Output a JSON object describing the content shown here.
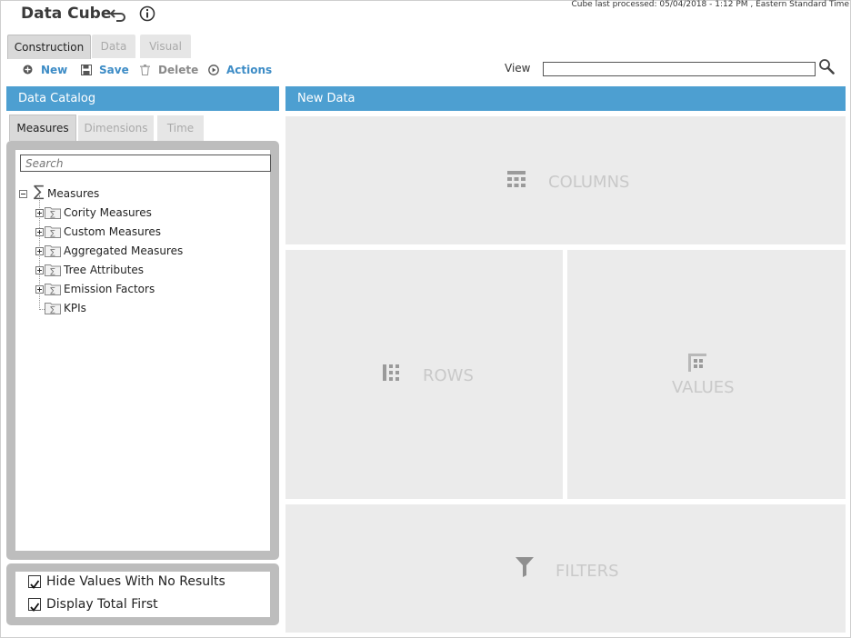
{
  "app": {
    "title": "Data Cube",
    "processed": "Cube last processed:  05/04/2018 - 1:12 PM , Eastern Standard Time"
  },
  "mode_tabs": [
    {
      "label": "Construction",
      "active": true
    },
    {
      "label": "Data",
      "active": false
    },
    {
      "label": "Visual",
      "active": false
    }
  ],
  "toolbar": {
    "new_label": "New",
    "save_label": "Save",
    "delete_label": "Delete",
    "actions_label": "Actions",
    "view_label": "View",
    "view_value": ""
  },
  "catalog": {
    "title": "Data Catalog",
    "tabs": [
      {
        "label": "Measures",
        "active": true
      },
      {
        "label": "Dimensions",
        "active": false
      },
      {
        "label": "Time",
        "active": false
      }
    ],
    "search_placeholder": "Search",
    "root": "Measures",
    "items": [
      {
        "label": "Cority Measures",
        "expandable": true
      },
      {
        "label": "Custom Measures",
        "expandable": true
      },
      {
        "label": "Aggregated Measures",
        "expandable": true
      },
      {
        "label": "Tree Attributes",
        "expandable": true
      },
      {
        "label": "Emission Factors",
        "expandable": true
      },
      {
        "label": "KPIs",
        "expandable": false
      }
    ],
    "options": [
      {
        "label": "Hide Values With No Results",
        "checked": true
      },
      {
        "label": "Display Total First",
        "checked": true
      }
    ]
  },
  "workspace": {
    "title": "New Data",
    "zones": {
      "columns": "COLUMNS",
      "rows": "ROWS",
      "values": "VALUES",
      "filters": "FILTERS"
    }
  },
  "colors": {
    "header_blue": "#4d9fd1",
    "link_blue": "#3d8cc6",
    "zone_bg": "#ebebeb",
    "zone_text": "#c9c9c9"
  }
}
